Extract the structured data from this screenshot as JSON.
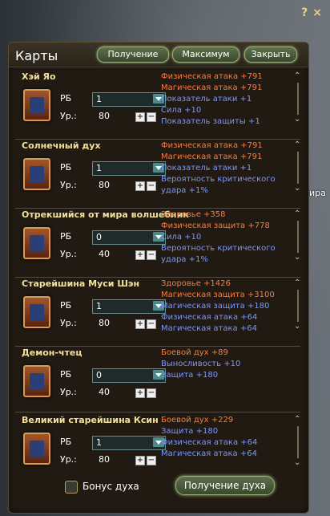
{
  "top_icons": {
    "help": "?",
    "close": "×"
  },
  "side_text": "ира",
  "window": {
    "title": "Карты",
    "buttons": {
      "get": "Получение",
      "max": "Максимум",
      "close": "Закрыть"
    }
  },
  "labels": {
    "rb": "РБ",
    "level": "Ур.:"
  },
  "cards": [
    {
      "name": "Хэй Яо",
      "rb": "1",
      "level": "80",
      "stats": [
        {
          "text": "Физическая атака +791",
          "color": "orange"
        },
        {
          "text": "Магическая атака +791",
          "color": "orange"
        },
        {
          "text": "Показатель атаки +1",
          "color": "blue"
        },
        {
          "text": "Сила +10",
          "color": "blue"
        },
        {
          "text": "Показатель защиты +1",
          "color": "blue"
        }
      ]
    },
    {
      "name": "Солнечный дух",
      "rb": "1",
      "level": "80",
      "stats": [
        {
          "text": "Физическая атака +791",
          "color": "orange"
        },
        {
          "text": "Магическая атака +791",
          "color": "orange"
        },
        {
          "text": "Показатель атаки +1",
          "color": "blue"
        },
        {
          "text": "Вероятность критического",
          "color": "blue"
        },
        {
          "text": "удара +1%",
          "color": "blue"
        }
      ]
    },
    {
      "name": "Отрекшийся от мира волшебник",
      "rb": "0",
      "level": "40",
      "stats": [
        {
          "text": "Здоровье +358",
          "color": "orange"
        },
        {
          "text": "Физическая защита +778",
          "color": "orange"
        },
        {
          "text": "Сила +10",
          "color": "blue"
        },
        {
          "text": "Вероятность критического",
          "color": "blue"
        },
        {
          "text": "удара +1%",
          "color": "blue"
        }
      ]
    },
    {
      "name": "Старейшина Муси Шэн",
      "rb": "1",
      "level": "80",
      "stats": [
        {
          "text": "Здоровье +1426",
          "color": "orange"
        },
        {
          "text": "Магическая защита +3100",
          "color": "orange"
        },
        {
          "text": "Магическая защита +180",
          "color": "blue"
        },
        {
          "text": "Физическая атака +64",
          "color": "blue"
        },
        {
          "text": "Магическая атака +64",
          "color": "blue"
        }
      ]
    },
    {
      "name": "Демон-чтец",
      "rb": "0",
      "level": "40",
      "stats": [
        {
          "text": "Боевой дух +89",
          "color": "orange"
        },
        {
          "text": "Выносливость +10",
          "color": "blue"
        },
        {
          "text": "Защита +180",
          "color": "blue"
        }
      ]
    },
    {
      "name": "Великий старейшина Ксин",
      "rb": "1",
      "level": "80",
      "stats": [
        {
          "text": "Боевой дух +229",
          "color": "orange"
        },
        {
          "text": "Защита +180",
          "color": "blue"
        },
        {
          "text": "Физическая атака +64",
          "color": "blue"
        },
        {
          "text": "Магическая атака +64",
          "color": "blue"
        }
      ]
    }
  ],
  "bottom": {
    "checkbox_label": "Бонус духа",
    "button": "Получение духа"
  },
  "colors": {
    "orange": "#ff7a3a",
    "blue": "#7a96ff",
    "gold": "#f4e09a"
  }
}
